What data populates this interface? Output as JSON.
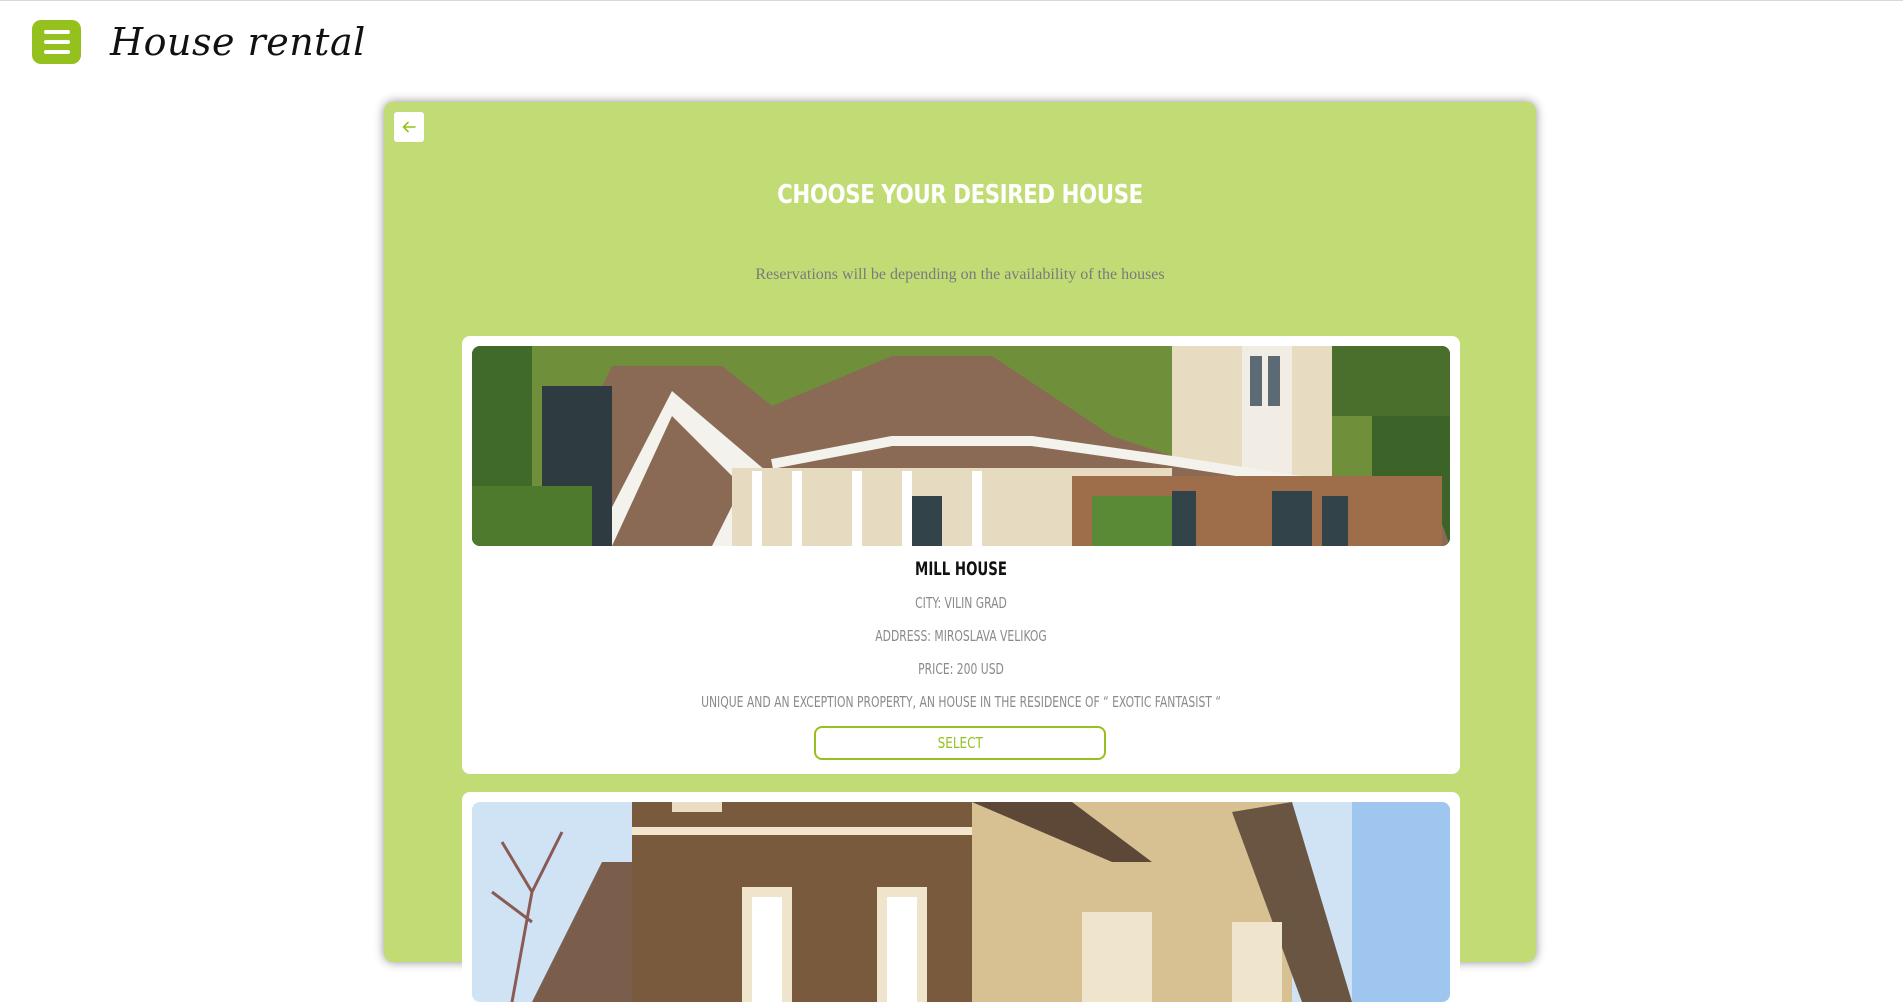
{
  "header": {
    "menu_icon": "hamburger-menu-icon",
    "brand": "House rental"
  },
  "panel": {
    "back_icon": "arrow-left-icon",
    "title": "CHOOSE YOUR DESIRED HOUSE",
    "subtitle": "Reservations will be depending on the availability of the houses"
  },
  "houses": [
    {
      "name": "MILL HOUSE",
      "city": "CITY: VILIN GRAD",
      "address": "ADDRESS: MIROSLAVA VELIKOG",
      "price": "PRICE: 200 USD",
      "description": "UNIQUE AND AN EXCEPTION PROPERTY, AN HOUSE IN THE RESIDENCE OF “ EXOTIC FANTASIST “",
      "select_label": "SELECT"
    }
  ],
  "colors": {
    "accent": "#95c11f",
    "panel_bg": "#c2dc75",
    "muted_text": "#8a8a8a"
  }
}
